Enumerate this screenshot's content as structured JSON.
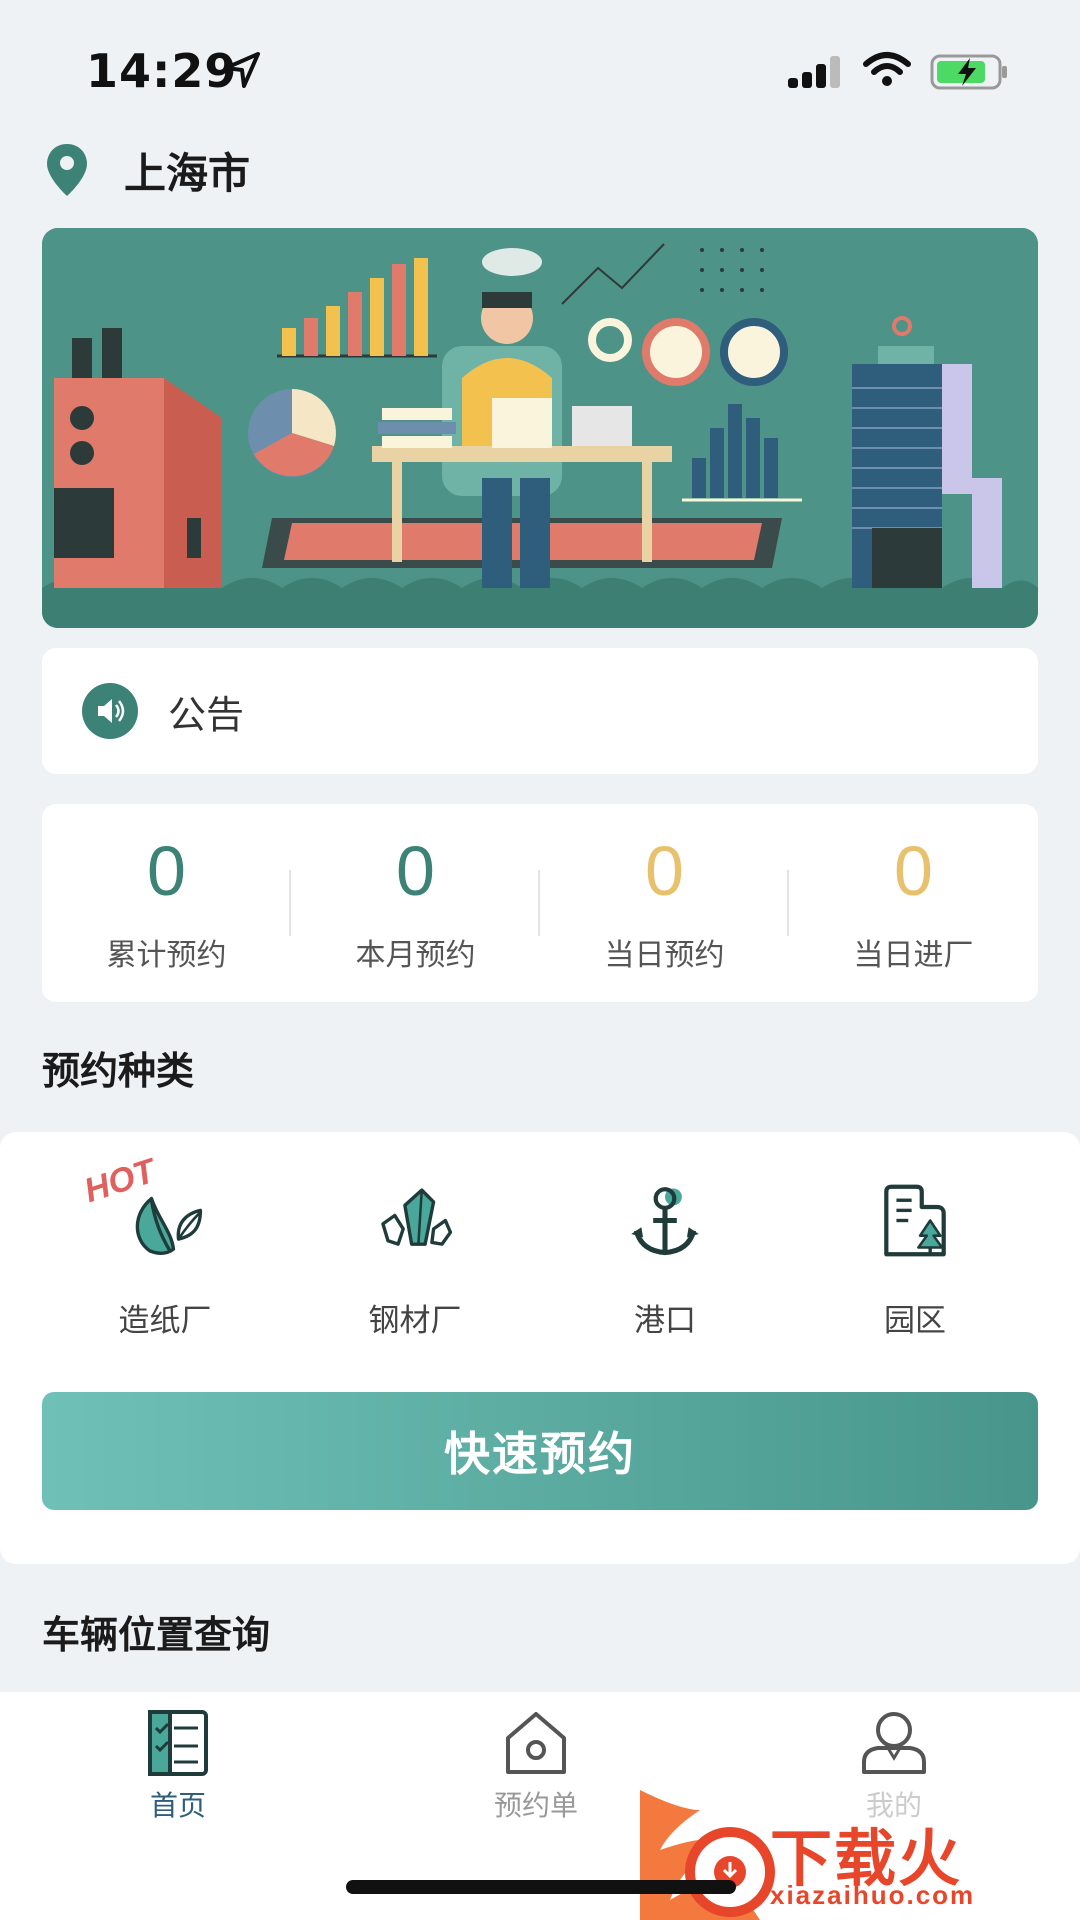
{
  "status_bar": {
    "time": "14:29"
  },
  "location": {
    "city": "上海市"
  },
  "notice": {
    "label": "公告"
  },
  "stats": [
    {
      "value": "0",
      "label": "累计预约",
      "color": "#3d8276"
    },
    {
      "value": "0",
      "label": "本月预约",
      "color": "#3d8276"
    },
    {
      "value": "0",
      "label": "当日预约",
      "color": "#e8c16e"
    },
    {
      "value": "0",
      "label": "当日进厂",
      "color": "#e8c16e"
    }
  ],
  "types": {
    "title": "预约种类",
    "hot_badge": "HOT",
    "items": [
      {
        "label": "造纸厂",
        "icon": "leaf-icon"
      },
      {
        "label": "钢材厂",
        "icon": "crystal-icon"
      },
      {
        "label": "港口",
        "icon": "anchor-icon"
      },
      {
        "label": "园区",
        "icon": "building-icon"
      }
    ],
    "quick_button": "快速预约"
  },
  "vehicle": {
    "title": "车辆位置查询"
  },
  "tabbar": {
    "items": [
      {
        "label": "首页",
        "icon": "checklist-icon",
        "active": true
      },
      {
        "label": "预约单",
        "icon": "house-icon",
        "active": false
      },
      {
        "label": "我的",
        "icon": "user-icon",
        "active": false
      }
    ]
  },
  "watermark": {
    "text": "下载火",
    "sub": "xiazaihuo.com"
  },
  "colors": {
    "accent": "#3d8276",
    "gold": "#e8c16e",
    "background": "#eff2f5"
  }
}
